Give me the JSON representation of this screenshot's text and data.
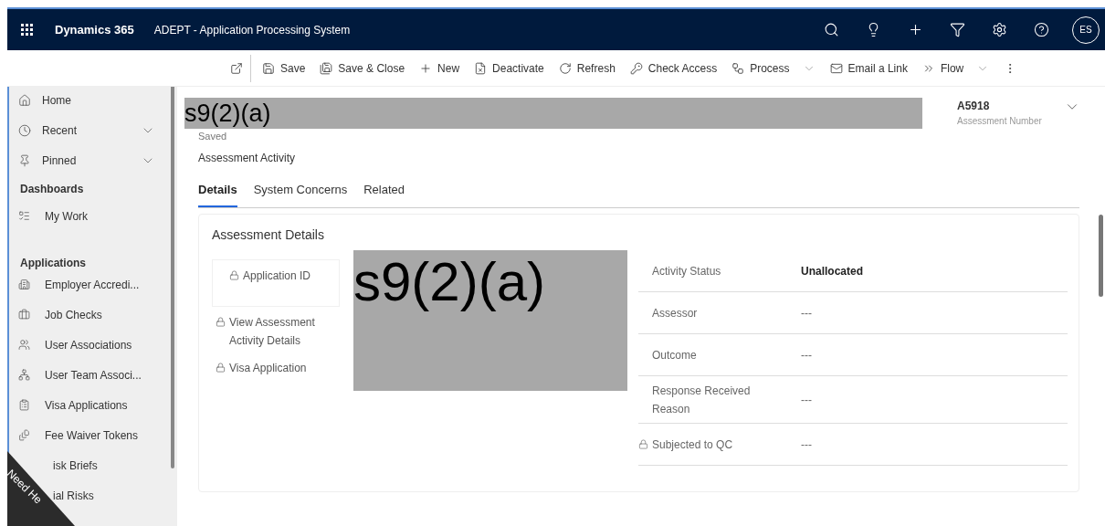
{
  "topbar": {
    "brand": "Dynamics 365",
    "app_title": "ADEPT - Application Processing System",
    "avatar": "ES"
  },
  "commands": [
    {
      "kind": "popout"
    },
    {
      "kind": "save",
      "label": "Save"
    },
    {
      "kind": "saveclose",
      "label": "Save & Close"
    },
    {
      "kind": "new",
      "label": "New"
    },
    {
      "kind": "deactivate",
      "label": "Deactivate"
    },
    {
      "kind": "refresh",
      "label": "Refresh"
    },
    {
      "kind": "access",
      "label": "Check Access"
    },
    {
      "kind": "process",
      "label": "Process",
      "dropdown": true
    },
    {
      "kind": "email",
      "label": "Email a Link"
    },
    {
      "kind": "flow",
      "label": "Flow",
      "dropdown": true
    },
    {
      "kind": "more"
    }
  ],
  "sidebar": {
    "items": [
      {
        "kind": "home",
        "label": "Home",
        "expandable": false
      },
      {
        "kind": "recent",
        "label": "Recent",
        "expandable": true
      },
      {
        "kind": "pinned",
        "label": "Pinned",
        "expandable": true
      }
    ],
    "sections": [
      {
        "title": "Dashboards",
        "items": [
          {
            "kind": "work",
            "label": "My Work"
          }
        ]
      },
      {
        "title": "Applications",
        "items": [
          {
            "kind": "employer",
            "label": "Employer Accredi..."
          },
          {
            "kind": "job",
            "label": "Job Checks"
          },
          {
            "kind": "users",
            "label": "User Associations"
          },
          {
            "kind": "team",
            "label": "User Team Associ..."
          },
          {
            "kind": "visa",
            "label": "Visa Applications"
          },
          {
            "kind": "fee",
            "label": "Fee Waiver Tokens"
          },
          {
            "kind": "risk",
            "label": "isk Briefs"
          },
          {
            "kind": "risk2",
            "label": "ial Risks"
          }
        ]
      }
    ]
  },
  "help_tab": {
    "label": "Need He"
  },
  "record": {
    "title_redaction": "s9(2)(a)",
    "save_status": "Saved",
    "entity": "Assessment Activity",
    "number": "A5918",
    "number_label": "Assessment Number"
  },
  "tabs": [
    {
      "label": "Details",
      "selected": true
    },
    {
      "label": "System Concerns",
      "selected": false
    },
    {
      "label": "Related",
      "selected": false
    }
  ],
  "section": {
    "title": "Assessment Details",
    "redaction": "s9(2)(a)",
    "left_fields": [
      {
        "label": "Application ID",
        "locked": true
      },
      {
        "label": "View Assessment Activity Details",
        "locked": true
      },
      {
        "label": "Visa Application",
        "locked": true
      }
    ],
    "right_fields": [
      {
        "label": "Activity Status",
        "value": "Unallocated",
        "locked": false,
        "bold": true
      },
      {
        "label": "Assessor",
        "value": "---",
        "locked": false,
        "bold": false
      },
      {
        "label": "Outcome",
        "value": "---",
        "locked": false,
        "bold": false
      },
      {
        "label": "Response Received Reason",
        "value": "---",
        "locked": false,
        "bold": false
      },
      {
        "label": "Subjected to QC",
        "value": "---",
        "locked": true,
        "bold": false
      }
    ]
  }
}
